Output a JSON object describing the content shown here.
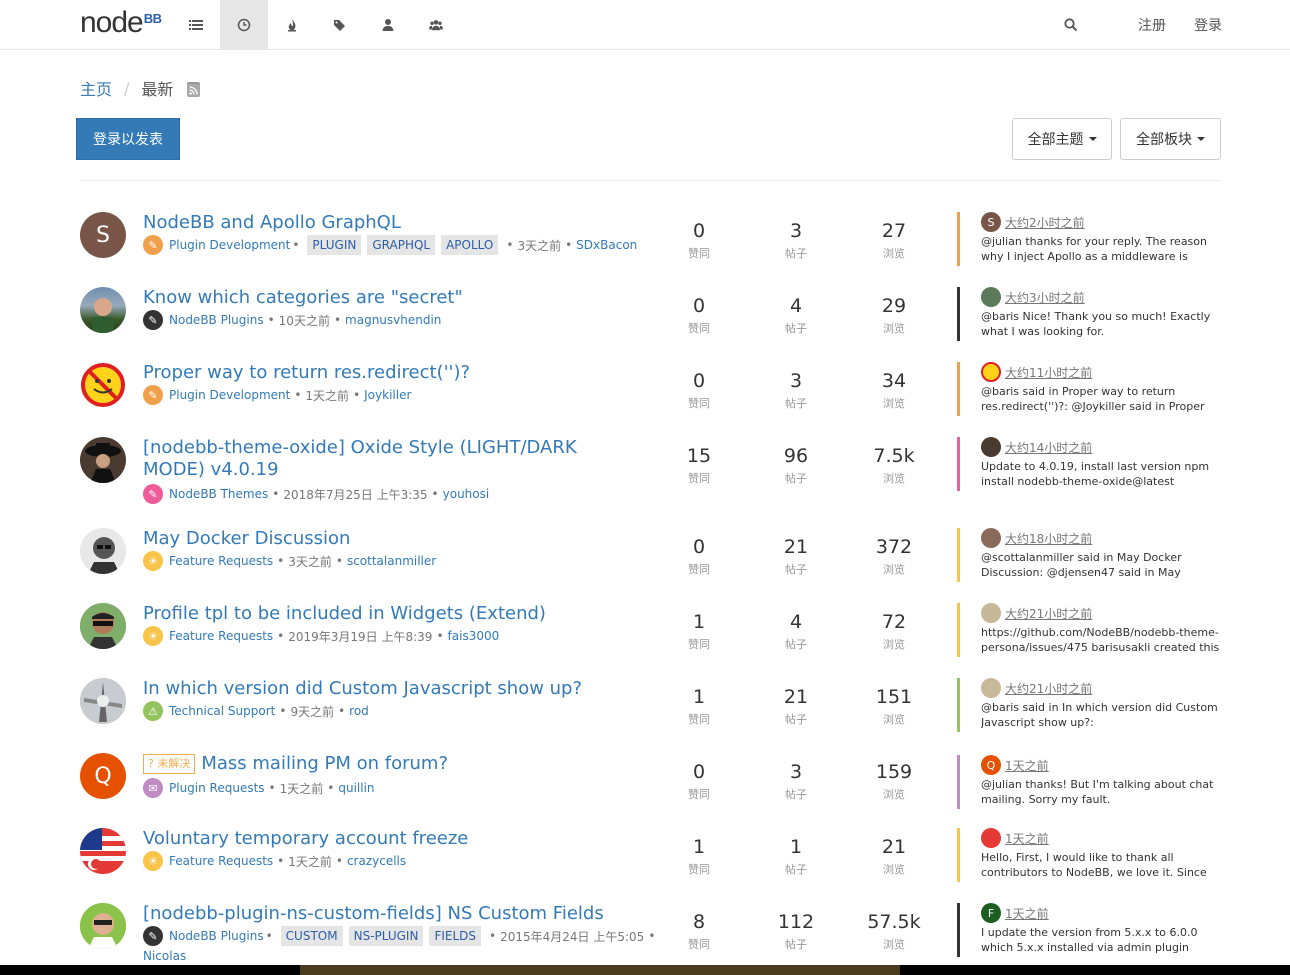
{
  "brand": {
    "main": "node",
    "suffix": "BB"
  },
  "nav": {
    "icons": [
      "list-icon",
      "clock-icon",
      "fire-icon",
      "tags-icon",
      "user-icon",
      "users-icon"
    ],
    "register": "注册",
    "login": "登录"
  },
  "breadcrumb": {
    "home": "主页",
    "current": "最新"
  },
  "actions": {
    "post": "登录以发表",
    "filter_topics": "全部主题",
    "filter_categories": "全部板块"
  },
  "labels": {
    "votes": "赞同",
    "posts": "帖子",
    "views": "浏览"
  },
  "topics": [
    {
      "title": "NodeBB and Apollo GraphQL",
      "category": "Plugin Development",
      "tags": [
        "PLUGIN",
        "GRAPHQL",
        "APOLLO"
      ],
      "time": "3天之前",
      "author": "SDxBacon",
      "votes": "0",
      "posts": "3",
      "views": "27",
      "avatar_letter": "S",
      "teaser_time": "大约2小时之前",
      "teaser_text": "@julian thanks for your reply. The reason why I inject Apollo as a middleware is"
    },
    {
      "title": "Know which categories are \"secret\"",
      "category": "NodeBB Plugins",
      "tags": [],
      "time": "10天之前",
      "author": "magnusvhendin",
      "votes": "0",
      "posts": "4",
      "views": "29",
      "teaser_time": "大约3小时之前",
      "teaser_text": "@baris Nice! Thank you so much! Exactly what I was looking for."
    },
    {
      "title": "Proper way to return res.redirect('')?",
      "category": "Plugin Development",
      "tags": [],
      "time": "1天之前",
      "author": "Joykiller",
      "votes": "0",
      "posts": "3",
      "views": "34",
      "teaser_time": "大约11小时之前",
      "teaser_text": "@baris said in Proper way to return res.redirect('')?: @Joykiller said in Proper way"
    },
    {
      "title": "[nodebb-theme-oxide] Oxide Style (LIGHT/DARK MODE) v4.0.19",
      "category": "NodeBB Themes",
      "tags": [],
      "time": "2018年7月25日 上午3:35",
      "author": "youhosi",
      "votes": "15",
      "posts": "96",
      "views": "7.5k",
      "teaser_time": "大约14小时之前",
      "teaser_text": "Update to 4.0.19, install last version npm install nodebb-theme-oxide@latest"
    },
    {
      "title": "May Docker Discussion",
      "category": "Feature Requests",
      "tags": [],
      "time": "3天之前",
      "author": "scottalanmiller",
      "votes": "0",
      "posts": "21",
      "views": "372",
      "teaser_time": "大约18小时之前",
      "teaser_text": "@scottalanmiller said in May Docker Discussion: @djensen47 said in May Docker"
    },
    {
      "title": "Profile tpl to be included in Widgets (Extend)",
      "category": "Feature Requests",
      "tags": [],
      "time": "2019年3月19日 上午8:39",
      "author": "fais3000",
      "votes": "1",
      "posts": "4",
      "views": "72",
      "teaser_time": "大约21小时之前",
      "teaser_text": "https://github.com/NodeBB/nodebb-theme-persona/issues/475 barisusakli created this"
    },
    {
      "title": "In which version did Custom Javascript show up?",
      "category": "Technical Support",
      "tags": [],
      "time": "9天之前",
      "author": "rod",
      "votes": "1",
      "posts": "21",
      "views": "151",
      "teaser_time": "大约21小时之前",
      "teaser_text": "@baris said in In which version did Custom Javascript show up?:"
    },
    {
      "badge": "未解决",
      "title": "Mass mailing PM on forum?",
      "category": "Plugin Requests",
      "tags": [],
      "time": "1天之前",
      "author": "quillin",
      "votes": "0",
      "posts": "3",
      "views": "159",
      "avatar_letter": "Q",
      "teaser_letter": "Q",
      "teaser_time": "1天之前",
      "teaser_text": "@julian thanks! But I'm talking about chat mailing. Sorry my fault."
    },
    {
      "title": "Voluntary temporary account freeze",
      "category": "Feature Requests",
      "tags": [],
      "time": "1天之前",
      "author": "crazycells",
      "votes": "1",
      "posts": "1",
      "views": "21",
      "teaser_time": "1天之前",
      "teaser_text": "Hello, First, I would like to thank all contributors to NodeBB, we love it. Since"
    },
    {
      "title": "[nodebb-plugin-ns-custom-fields] NS Custom Fields",
      "category": "NodeBB Plugins",
      "tags": [
        "CUSTOM",
        "NS-PLUGIN",
        "FIELDS"
      ],
      "time": "2015年4月24日 上午5:05",
      "author": "Nicolas",
      "votes": "8",
      "posts": "112",
      "views": "57.5k",
      "teaser_letter": "F",
      "teaser_time": "1天之前",
      "teaser_text": "I update the version from 5.x.x to 6.0.0 which 5.x.x installed via admin plugin portal. I can"
    }
  ],
  "colors": {
    "link": "#337ab7",
    "plugin_development": "#f0a04b",
    "nodebb_plugins": "#333333",
    "nodebb_themes": "#ee5c9a",
    "feature_requests": "#f8c44a",
    "technical_support": "#95c35f",
    "plugin_requests": "#c18cc4",
    "unsolved": "#f0ad4e"
  }
}
